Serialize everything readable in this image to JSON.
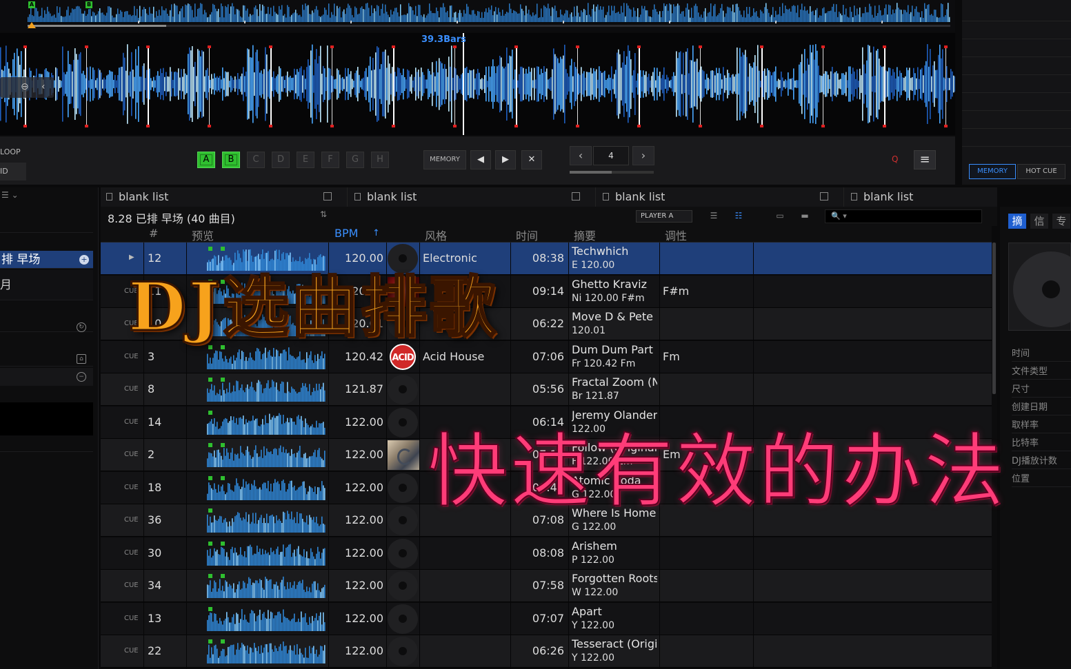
{
  "deck": {
    "overview_markers": [
      "A",
      "B"
    ],
    "bars_label": "39.3Bars",
    "loop_label": "LOOP",
    "id_label": "ID",
    "hot_cues": [
      {
        "label": "A",
        "active": true
      },
      {
        "label": "B",
        "active": true
      },
      {
        "label": "C",
        "active": false
      },
      {
        "label": "D",
        "active": false
      },
      {
        "label": "E",
        "active": false
      },
      {
        "label": "F",
        "active": false
      },
      {
        "label": "G",
        "active": false
      },
      {
        "label": "H",
        "active": false
      }
    ],
    "memory_label": "MEMORY",
    "beat_jump_value": "4",
    "q_label": "Q",
    "prev_icon": "◀",
    "next_icon": "▶",
    "close_icon": "✕",
    "beat_prev_icon": "‹",
    "beat_next_icon": "›",
    "menu_icon": "≡"
  },
  "right_deck": {
    "tab_memory": "MEMORY",
    "tab_hotcue": "HOT CUE"
  },
  "sidebar": {
    "top_icon": "☰ ⌄",
    "selected_playlist": "排 早场",
    "month_item": "月"
  },
  "tabs": [
    "blank list",
    "blank list",
    "blank list",
    "blank list"
  ],
  "playlist": {
    "title": "8.28 已排 早场 (40 曲目)",
    "sort_icon": "⇅",
    "player_select": "PLAYER A",
    "search_icon": "🔍 ▾"
  },
  "columns": {
    "num": "#",
    "preview": "预览",
    "bpm": "BPM",
    "bpm_sort": "↑",
    "genre": "风格",
    "time": "时间",
    "summary": "摘要",
    "key": "调性"
  },
  "tracks": [
    {
      "cue": "",
      "num": "12",
      "bpm": "120.00",
      "art": "disc",
      "genre": "Electronic",
      "time": "08:38",
      "title": "Techwhich",
      "sub": "E   120.00",
      "key": "",
      "selected": true
    },
    {
      "cue": "CUE",
      "num": "11",
      "bpm": "120.00",
      "art": "red",
      "genre": "",
      "time": "09:14",
      "title": "Ghetto Kraviz",
      "sub": "Ni  120.00   F#m",
      "key": "F#m",
      "selected": false
    },
    {
      "cue": "CUE",
      "num": "10",
      "bpm": "120.01",
      "art": "disc",
      "genre": "",
      "time": "06:22",
      "title": "Move D & Pete",
      "sub": "     120.01",
      "key": "",
      "selected": false
    },
    {
      "cue": "CUE",
      "num": "3",
      "bpm": "120.42",
      "art": "acid",
      "genre": "Acid House",
      "time": "07:06",
      "title": "Dum Dum Part",
      "sub": "Fr  120.42   Fm",
      "key": "Fm",
      "selected": false
    },
    {
      "cue": "CUE",
      "num": "8",
      "bpm": "121.87",
      "art": "disc",
      "genre": "",
      "time": "05:56",
      "title": "Fractal Zoom (N",
      "sub": "Br  121.87",
      "key": "",
      "selected": false
    },
    {
      "cue": "CUE",
      "num": "14",
      "bpm": "122.00",
      "art": "disc",
      "genre": "",
      "time": "06:14",
      "title": "Jeremy Olander",
      "sub": "     122.00",
      "key": "",
      "selected": false
    },
    {
      "cue": "CUE",
      "num": "2",
      "bpm": "122.00",
      "art": "photo",
      "genre": "",
      "time": "07:15",
      "title": "Follow (Original",
      "sub": "F   122.00   Em",
      "key": "Em",
      "selected": false
    },
    {
      "cue": "CUE",
      "num": "18",
      "bpm": "122.00",
      "art": "disc",
      "genre": "",
      "time": "08:48",
      "title": "Atomic Soda",
      "sub": "G   122.00",
      "key": "",
      "selected": false
    },
    {
      "cue": "CUE",
      "num": "36",
      "bpm": "122.00",
      "art": "disc",
      "genre": "",
      "time": "07:08",
      "title": "Where Is Home",
      "sub": "G   122.00",
      "key": "",
      "selected": false
    },
    {
      "cue": "CUE",
      "num": "30",
      "bpm": "122.00",
      "art": "disc",
      "genre": "",
      "time": "08:08",
      "title": "Arishem",
      "sub": "P   122.00",
      "key": "",
      "selected": false
    },
    {
      "cue": "CUE",
      "num": "34",
      "bpm": "122.00",
      "art": "disc",
      "genre": "",
      "time": "07:58",
      "title": "Forgotten Roots",
      "sub": "W  122.00",
      "key": "",
      "selected": false
    },
    {
      "cue": "CUE",
      "num": "13",
      "bpm": "122.00",
      "art": "disc",
      "genre": "",
      "time": "07:07",
      "title": "Apart",
      "sub": "Y   122.00",
      "key": "",
      "selected": false
    },
    {
      "cue": "CUE",
      "num": "22",
      "bpm": "122.00",
      "art": "disc",
      "genre": "",
      "time": "06:26",
      "title": "Tesseract (Origi",
      "sub": "Y   122.00",
      "key": "",
      "selected": false
    }
  ],
  "acid_label": "ACID",
  "info_panel": {
    "tabs": [
      "摘",
      "信",
      "专"
    ],
    "labels": [
      "时间",
      "文件类型",
      "尺寸",
      "创建日期",
      "取样率",
      "比特率",
      "DJ播放计数",
      "位置"
    ]
  },
  "overlay": {
    "title": "DJ选曲排歌",
    "subtitle": "快速有效的办法"
  },
  "colors": {
    "accent_blue": "#3a8fff",
    "selection": "#1f3f7a",
    "hotcue_green": "#2fbf2f",
    "title_orange": "#f7a21c",
    "subtitle_pink": "#ff3c78"
  }
}
